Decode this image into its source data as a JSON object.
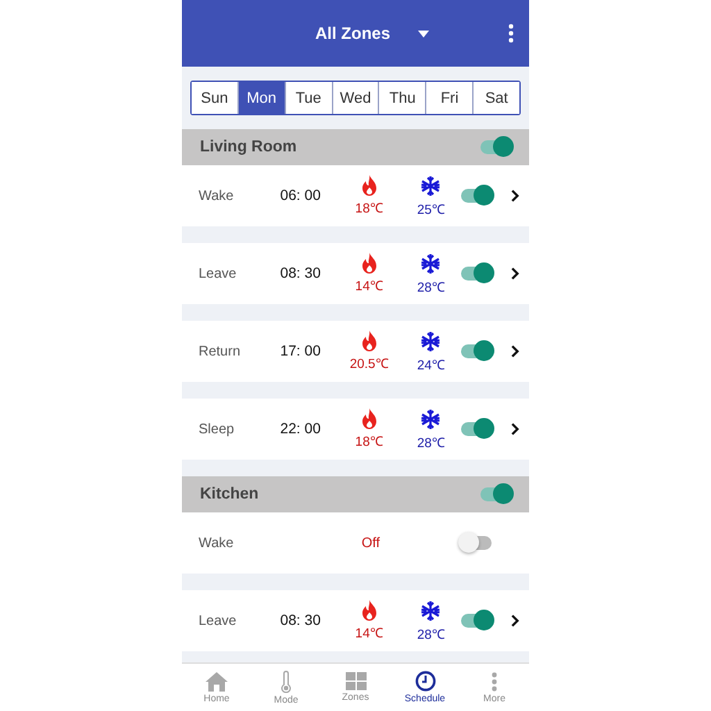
{
  "header": {
    "title": "All Zones"
  },
  "days": [
    {
      "label": "Sun",
      "selected": false
    },
    {
      "label": "Mon",
      "selected": true
    },
    {
      "label": "Tue",
      "selected": false
    },
    {
      "label": "Wed",
      "selected": false
    },
    {
      "label": "Thu",
      "selected": false
    },
    {
      "label": "Fri",
      "selected": false
    },
    {
      "label": "Sat",
      "selected": false
    }
  ],
  "zones": [
    {
      "name": "Living Room",
      "on": true,
      "events": [
        {
          "kind": "schedule",
          "name": "Wake",
          "time": "06: 00",
          "heat": "18℃",
          "cool": "25℃",
          "on": true
        },
        {
          "kind": "schedule",
          "name": "Leave",
          "time": "08: 30",
          "heat": "14℃",
          "cool": "28℃",
          "on": true
        },
        {
          "kind": "schedule",
          "name": "Return",
          "time": "17: 00",
          "heat": "20.5℃",
          "cool": "24℃",
          "on": true
        },
        {
          "kind": "schedule",
          "name": "Sleep",
          "time": "22: 00",
          "heat": "18℃",
          "cool": "28℃",
          "on": true
        }
      ]
    },
    {
      "name": "Kitchen",
      "on": true,
      "events": [
        {
          "kind": "off",
          "name": "Wake",
          "status": "Off",
          "on": false
        },
        {
          "kind": "schedule",
          "name": "Leave",
          "time": "08: 30",
          "heat": "14℃",
          "cool": "28℃",
          "on": true
        }
      ]
    }
  ],
  "nav": [
    {
      "label": "Home",
      "selected": false
    },
    {
      "label": "Mode",
      "selected": false
    },
    {
      "label": "Zones",
      "selected": false
    },
    {
      "label": "Schedule",
      "selected": true
    },
    {
      "label": "More",
      "selected": false
    }
  ]
}
